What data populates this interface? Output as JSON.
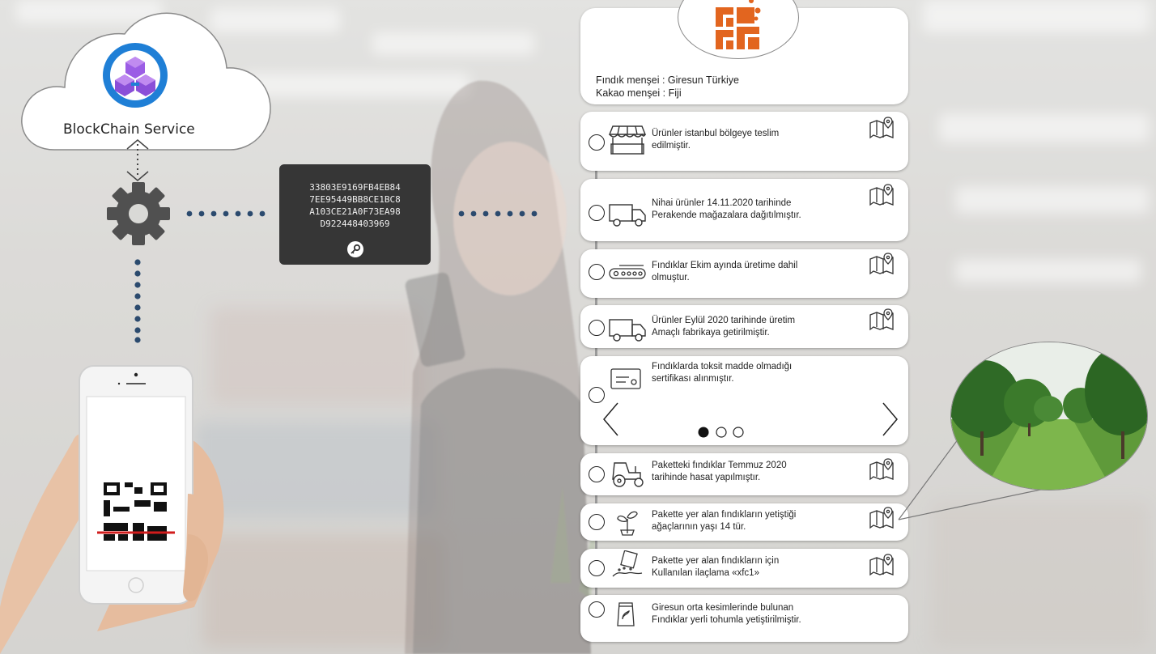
{
  "cloud": {
    "label": "BlockChain Service"
  },
  "hash": {
    "lines": [
      "33803E9169FB4EB84",
      "7EE95449BB8CE1BC8",
      "A103CE21A0F73EA98",
      "D922448403969"
    ]
  },
  "origin": {
    "line1": "Fındık menşei : Giresun Türkiye",
    "line2": "Kakao menşei : Fiji"
  },
  "timeline": [
    {
      "icon": "market-stall-icon",
      "line1": "Ürünler istanbul bölgeye teslim",
      "line2": "edilmiştir.",
      "map": true
    },
    {
      "icon": "delivery-truck-icon",
      "line1": "Nihai ürünler 14.11.2020 tarihinde",
      "line2": "Perakende mağazalara dağıtılmıştır.",
      "map": true
    },
    {
      "icon": "conveyor-belt-icon",
      "line1": "Fındıklar Ekim ayında üretime dahil",
      "line2": "olmuştur.",
      "map": true
    },
    {
      "icon": "delivery-truck-icon",
      "line1": "Ürünler Eylül 2020 tarihinde üretim",
      "line2": "Amaçlı fabrikaya getirilmiştir.",
      "map": true
    },
    {
      "icon": "certificate-icon",
      "line1": "Fındıklarda toksit madde olmadığı",
      "line2": "sertifikası alınmıştır.",
      "map": false
    },
    {
      "icon": "tractor-icon",
      "line1": "Paketteki fındıklar Temmuz 2020",
      "line2": "tarihinde hasat yapılmıştır.",
      "map": true
    },
    {
      "icon": "sapling-icon",
      "line1": "Pakette yer alan fındıkların yetiştiği",
      "line2": "ağaçlarının yaşı 14 tür.",
      "map": true
    },
    {
      "icon": "spraying-icon",
      "line1": "Pakette yer alan fındıkların için",
      "line2": "Kullanılan ilaçlama «xfc1»",
      "map": true
    },
    {
      "icon": "seed-bag-icon",
      "line1": "Giresun orta kesimlerinde bulunan",
      "line2": "Fındıklar yerli tohumla yetiştirilmiştir.",
      "map": false
    }
  ],
  "carousel": {
    "active_index": 0,
    "count": 3
  },
  "colors": {
    "accent_orange": "#e2651f",
    "dots_blue": "#2b4a6e",
    "azure_blue": "#1f7fd6",
    "purple": "#8a4fd8"
  }
}
